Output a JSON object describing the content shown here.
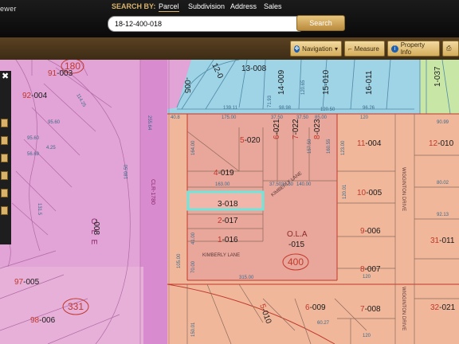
{
  "app": {
    "title": "ewer"
  },
  "search": {
    "by_label": "SEARCH BY:",
    "tabs": [
      "Parcel",
      "Subdivision",
      "Address",
      "Sales"
    ],
    "value": "18-12-400-018",
    "button": "Search"
  },
  "toolbar": {
    "navigation": "Navigation",
    "measure": "Measure",
    "property_info": "Property Info"
  },
  "colors": {
    "pink_zone": "#e2a3d6",
    "salmon_zone": "#f0b79b",
    "blue_zone": "#9fd3e6",
    "green_zone": "#c8e6a6",
    "highlight": "#6ee6dc",
    "boundary": "#c0392b",
    "parcel_line": "#6e6e6e"
  },
  "map": {
    "circle_labels": [
      "180",
      "400",
      "331"
    ],
    "subdivision_labels": [
      "O L E",
      "O.L.A"
    ],
    "street_labels": [
      "KIMBERLY LANE",
      "KIMBERLY LANE",
      "WIGGINTON DRIVE",
      "WIGGINTON DRIVE"
    ],
    "section_code": "CLR-1780",
    "parcels": [
      {
        "id": "91",
        "num": "-003"
      },
      {
        "id": "92",
        "num": "-004"
      },
      {
        "id": "",
        "num": "-008"
      },
      {
        "id": "97",
        "num": "-005"
      },
      {
        "id": "98",
        "num": "-006"
      },
      {
        "id": "",
        "num": "-005"
      },
      {
        "id": "12",
        "num": "-0"
      },
      {
        "id": "13",
        "num": "-008"
      },
      {
        "id": "14",
        "num": "-009"
      },
      {
        "id": "15",
        "num": "-010"
      },
      {
        "id": "16",
        "num": "-011"
      },
      {
        "id": "1",
        "num": "-037"
      },
      {
        "id": "5",
        "num": "-020"
      },
      {
        "id": "4",
        "num": "-019"
      },
      {
        "id": "6",
        "num": "-021"
      },
      {
        "id": "7",
        "num": "-022"
      },
      {
        "id": "8",
        "num": "-023"
      },
      {
        "id": "11",
        "num": "-004"
      },
      {
        "id": "12",
        "num": "-010"
      },
      {
        "id": "3",
        "num": "-018"
      },
      {
        "id": "2",
        "num": "-017"
      },
      {
        "id": "1",
        "num": "-016"
      },
      {
        "id": "10",
        "num": "-005"
      },
      {
        "id": "9",
        "num": "-006"
      },
      {
        "id": "8",
        "num": "-007"
      },
      {
        "id": "7",
        "num": "-008"
      },
      {
        "id": "6",
        "num": "-009"
      },
      {
        "id": "5",
        "num": "-010"
      },
      {
        "id": "31",
        "num": "-011"
      },
      {
        "id": "32",
        "num": "-021"
      },
      {
        "id": "",
        "num": "-015"
      }
    ],
    "dims": [
      "175.00",
      "37.50",
      "37.50",
      "85.00",
      "120",
      "164.00",
      "163.00",
      "140.00",
      "37.50",
      "37.50",
      "315.00",
      "120",
      "90.99",
      "120.50",
      "41.00",
      "70.00",
      "139.11",
      "98.98",
      "96.26",
      "95.60",
      "105.00",
      "123.00",
      "157.50",
      "160.55",
      "120.01",
      "80.02",
      "92.13",
      "71.93",
      "150.01",
      "40.8",
      "60.27",
      "120",
      "255.64",
      "189.50",
      "131.5",
      "114.25",
      "56.69",
      "95.60",
      "4.25",
      "120.65"
    ]
  }
}
